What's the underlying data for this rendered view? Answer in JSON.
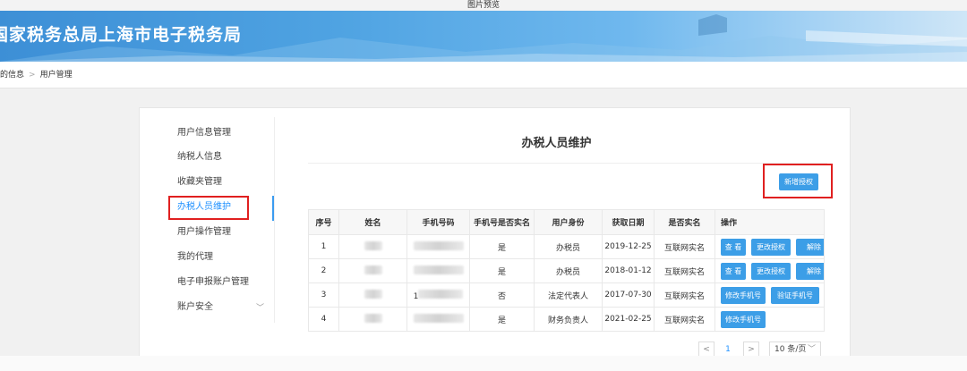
{
  "preview": {
    "title": "图片预览"
  },
  "header": {
    "title": "国家税务总局上海市电子税务局"
  },
  "breadcrumb": {
    "parent": "的信息",
    "separator": ">",
    "current": "用户管理"
  },
  "sidebar": {
    "items": [
      {
        "label": "用户信息管理"
      },
      {
        "label": "纳税人信息"
      },
      {
        "label": "收藏夹管理"
      },
      {
        "label": "办税人员维护"
      },
      {
        "label": "用户操作管理"
      },
      {
        "label": "我的代理"
      },
      {
        "label": "电子申报账户管理"
      },
      {
        "label": "账户安全"
      }
    ],
    "active_index": 3
  },
  "main": {
    "title": "办税人员维护",
    "add_button": "新增授权",
    "table": {
      "headers": [
        "序号",
        "姓名",
        "手机号码",
        "手机号是否实名",
        "用户身份",
        "获取日期",
        "是否实名",
        "操作"
      ],
      "rows": [
        {
          "no": "1",
          "realname_phone": "是",
          "role": "办税员",
          "date": "2019-12-25",
          "realname": "互联网实名",
          "actions": [
            "查 看",
            "更改授权",
            "解除"
          ]
        },
        {
          "no": "2",
          "realname_phone": "是",
          "role": "办税员",
          "date": "2018-01-12",
          "realname": "互联网实名",
          "actions": [
            "查 看",
            "更改授权",
            "解除"
          ]
        },
        {
          "no": "3",
          "phone_prefix": "1",
          "realname_phone": "否",
          "role": "法定代表人",
          "date": "2017-07-30",
          "realname": "互联网实名",
          "actions": [
            "修改手机号",
            "验证手机号"
          ]
        },
        {
          "no": "4",
          "realname_phone": "是",
          "role": "财务负责人",
          "date": "2021-02-25",
          "realname": "互联网实名",
          "actions": [
            "修改手机号"
          ]
        }
      ]
    },
    "pagination": {
      "prev": "<",
      "current_page": "1",
      "next": ">",
      "page_size": "10 条/页"
    }
  },
  "colors": {
    "accent": "#3c9ee7",
    "highlight_box": "#e02020",
    "banner": "#4fa3e2"
  }
}
